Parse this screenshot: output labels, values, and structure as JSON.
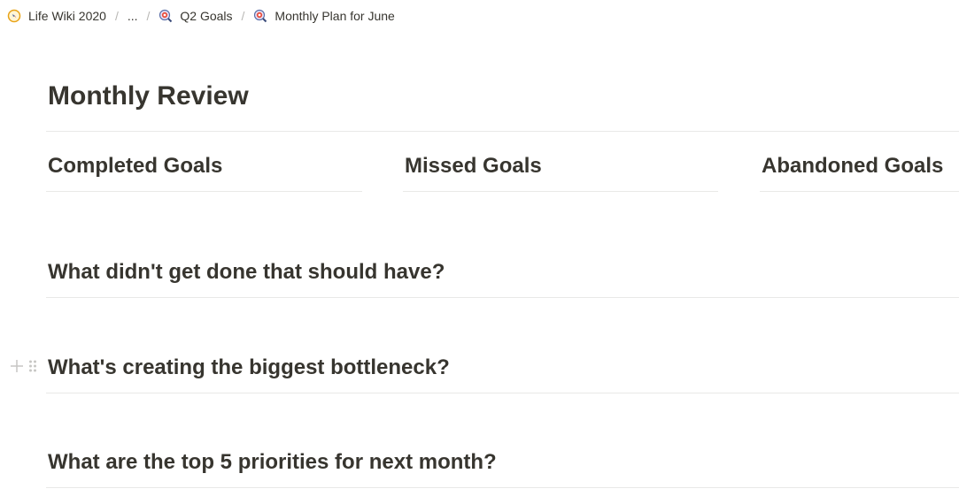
{
  "breadcrumb": {
    "items": [
      {
        "label": "Life Wiki 2020",
        "icon": "compass-icon"
      },
      {
        "label": "..."
      },
      {
        "label": "Q2 Goals",
        "icon": "target-magnifier-icon"
      },
      {
        "label": "Monthly Plan for June",
        "icon": "target-magnifier-icon"
      }
    ],
    "separator": "/"
  },
  "page": {
    "title": "Monthly Review",
    "columns": [
      {
        "heading": "Completed Goals"
      },
      {
        "heading": "Missed Goals"
      },
      {
        "heading": "Abandoned Goals"
      }
    ],
    "questions": [
      "What didn't get done that should have?",
      "What's creating the biggest bottleneck?",
      "What are the top 5 priorities for next month?"
    ]
  },
  "colors": {
    "text": "#37352f",
    "divider": "#e9e9e7",
    "handle": "#c7c6c4"
  }
}
